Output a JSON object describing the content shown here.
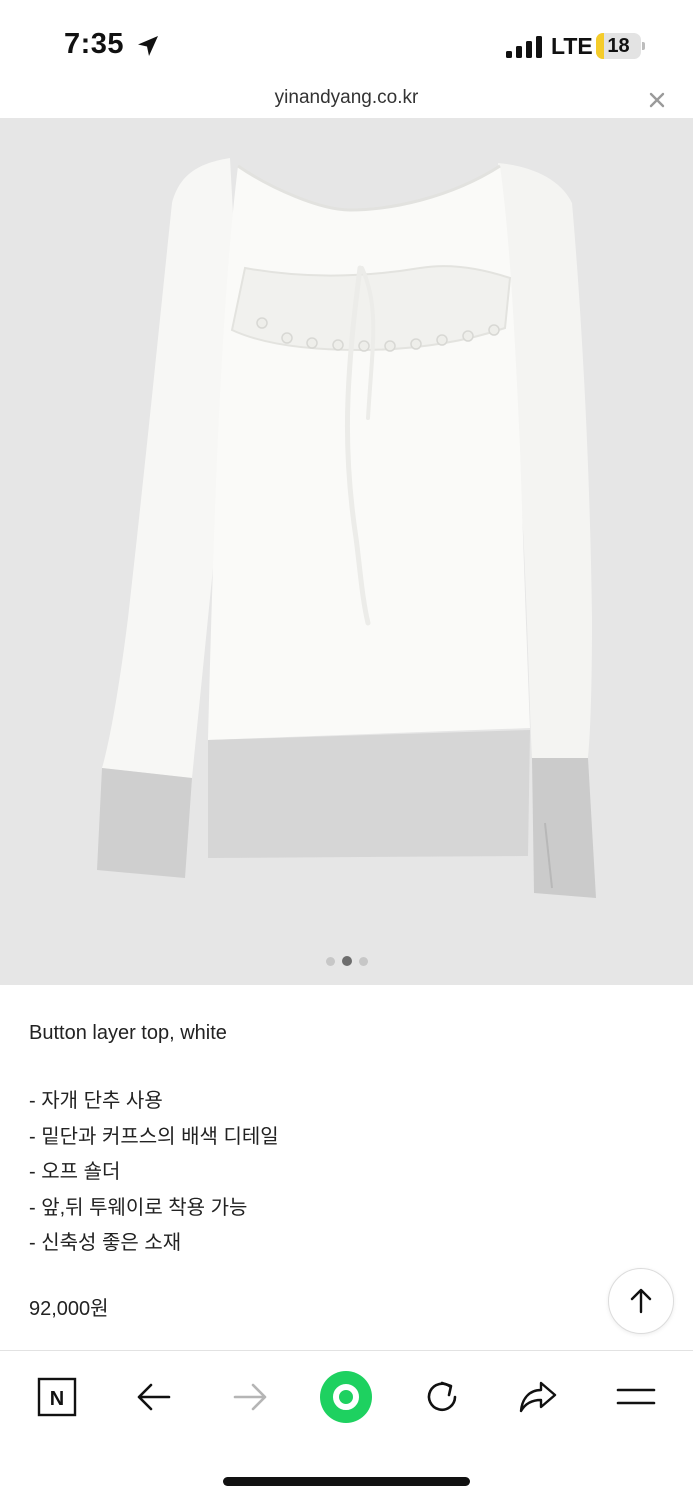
{
  "status_bar": {
    "time": "7:35",
    "network": "LTE",
    "battery": "18",
    "battery_level": 0.18,
    "location_icon": "location-arrow-icon",
    "signal_icon": "cellular-signal-icon"
  },
  "browser": {
    "url": "yinandyang.co.kr",
    "close_icon": "close-icon"
  },
  "gallery": {
    "image_alt_icon": "white-long-sleeve-top-image",
    "total_slides": 3,
    "current_slide": 2
  },
  "product": {
    "title": "Button layer top, white",
    "features": [
      "- 자개 단추 사용",
      "- 밑단과 커프스의 배색 디테일",
      "- 오프 숄더",
      "- 앞,뒤 투웨이로 착용 가능",
      "- 신축성 좋은 소재"
    ],
    "price": "92,000원"
  },
  "toolbar": {
    "naver_icon": "naver-n-icon",
    "naver_letter": "N",
    "back_icon": "arrow-left-icon",
    "forward_icon": "arrow-right-icon",
    "green_dot_icon": "green-dot-icon",
    "reload_icon": "reload-icon",
    "share_icon": "share-icon",
    "menu_icon": "menu-icon"
  },
  "colors": {
    "accent_green": "#1ed160",
    "battery_yellow": "#f5cc2a",
    "image_bg": "#e6e6e6",
    "cuff_gray": "#cfcfcf"
  }
}
